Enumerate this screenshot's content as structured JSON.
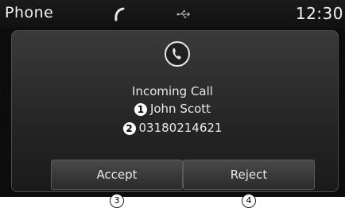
{
  "status_bar": {
    "title": "Phone",
    "time": "12:30",
    "icons": [
      "handset-icon",
      "usb-icon"
    ]
  },
  "call": {
    "icon": "phone-ring-icon",
    "status": "Incoming Call",
    "caller_name": "John Scott",
    "caller_number": "03180214621"
  },
  "callouts": {
    "name_marker": "1",
    "number_marker": "2",
    "accept_marker": "3",
    "reject_marker": "4"
  },
  "buttons": {
    "accept_label": "Accept",
    "reject_label": "Reject"
  },
  "colors": {
    "background": "#0c0c0c",
    "panel": "#2a2a2a",
    "text": "#e8e8e8"
  }
}
